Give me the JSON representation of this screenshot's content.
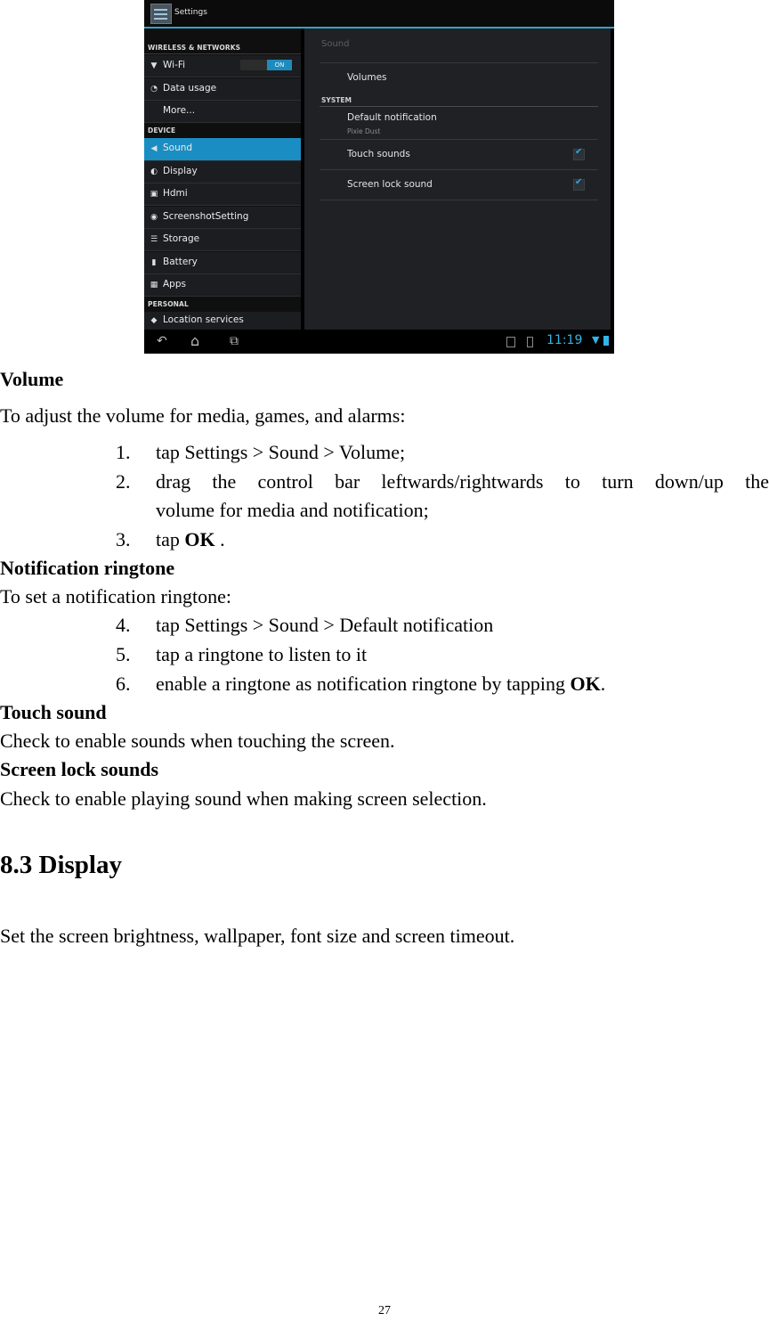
{
  "screenshot": {
    "app_title": "Settings",
    "categories": {
      "wireless": "WIRELESS & NETWORKS",
      "device": "DEVICE",
      "personal": "PERSONAL"
    },
    "wifi_toggle": "ON",
    "sidebar": [
      {
        "label": "Wi-Fi",
        "icon": "wifi-icon"
      },
      {
        "label": "Data usage",
        "icon": "data-usage-icon"
      },
      {
        "label": "More...",
        "icon": ""
      },
      {
        "label": "Sound",
        "icon": "speaker-icon",
        "selected": true
      },
      {
        "label": "Display",
        "icon": "brightness-icon"
      },
      {
        "label": "Hdmi",
        "icon": "hdmi-icon"
      },
      {
        "label": "ScreenshotSetting",
        "icon": "camera-icon"
      },
      {
        "label": "Storage",
        "icon": "storage-icon"
      },
      {
        "label": "Battery",
        "icon": "battery-icon"
      },
      {
        "label": "Apps",
        "icon": "apps-icon"
      },
      {
        "label": "Location services",
        "icon": "location-icon"
      }
    ],
    "panel": {
      "header": "Sound",
      "volumes": "Volumes",
      "system_label": "SYSTEM",
      "default_notification": "Default notification",
      "default_notification_value": "Pixie Dust",
      "touch_sounds": "Touch sounds",
      "touch_sounds_checked": true,
      "screen_lock_sound": "Screen lock sound",
      "screen_lock_sound_checked": true
    },
    "status_bar": {
      "time": "11:19"
    },
    "accent_color": "#33b5e5"
  },
  "document": {
    "volume_heading": "Volume",
    "volume_intro": "To adjust the volume for media, games, and alarms:",
    "volume_steps": [
      {
        "num": "1.",
        "text": "tap Settings > Sound > Volume;"
      },
      {
        "num": "2.",
        "text_line1": "drag the control bar leftwards/rightwards to turn down/up the",
        "text_line2": "volume for media and notification;"
      },
      {
        "num": "3.",
        "text_pre": "tap ",
        "bold": "OK",
        "text_post": " ."
      }
    ],
    "notif_heading": "Notification ringtone",
    "notif_intro": "To set a notification ringtone:",
    "notif_steps": [
      {
        "num": "4.",
        "text": "tap Settings > Sound > Default notification"
      },
      {
        "num": "5.",
        "text": "tap a ringtone to listen to it"
      },
      {
        "num": "6.",
        "text_pre": "enable a ringtone as notification ringtone by tapping ",
        "bold": "OK",
        "text_post": "."
      }
    ],
    "touch_heading": "Touch sound",
    "touch_text": "Check to enable sounds when touching the screen.",
    "lock_heading": "Screen lock sounds",
    "lock_text": "Check to enable playing sound when making screen selection.",
    "section_title": "8.3 Display",
    "section_text": "Set the screen brightness, wallpaper, font size and screen timeout.",
    "page_number": "27"
  }
}
